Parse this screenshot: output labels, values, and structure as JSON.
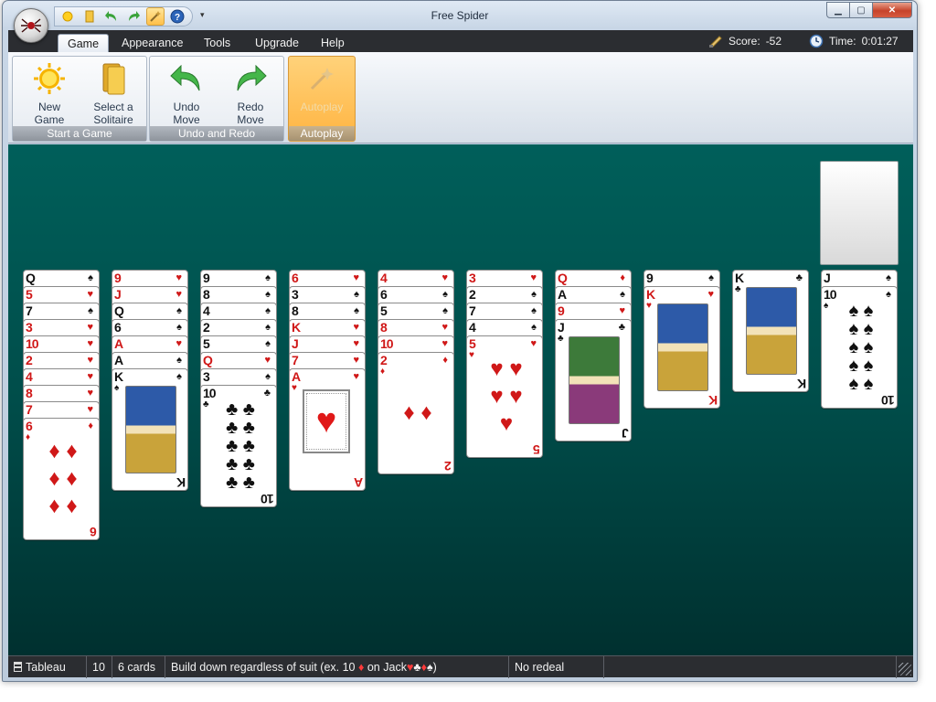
{
  "window": {
    "title": "Free Spider"
  },
  "tabs": [
    {
      "label": "Game",
      "active": true
    },
    {
      "label": "Appearance",
      "active": false
    },
    {
      "label": "Tools",
      "active": false
    },
    {
      "label": "Upgrade",
      "active": false
    },
    {
      "label": "Help",
      "active": false
    }
  ],
  "header": {
    "score_label": "Score:",
    "score": "-52",
    "time_label": "Time:",
    "time": "0:01:27"
  },
  "ribbon": {
    "groups": [
      {
        "label": "Start a Game",
        "buttons": [
          {
            "line1": "New",
            "line2": "Game",
            "icon": "sun-icon"
          },
          {
            "line1": "Select a",
            "line2": "Solitaire",
            "icon": "cards-icon"
          }
        ]
      },
      {
        "label": "Undo and Redo",
        "buttons": [
          {
            "line1": "Undo",
            "line2": "Move",
            "icon": "undo-arrow-icon"
          },
          {
            "line1": "Redo",
            "line2": "Move",
            "icon": "redo-arrow-icon"
          }
        ]
      },
      {
        "label": "Autoplay",
        "buttons": [
          {
            "line1": "Autoplay",
            "line2": "",
            "icon": "wand-icon",
            "disabled": true
          }
        ]
      }
    ]
  },
  "tableau": [
    {
      "column": 1,
      "cards": [
        "Q♠",
        "5♥",
        "7♠",
        "3♥",
        "10♥",
        "2♥",
        "4♥",
        "8♥",
        "7♥",
        "6♦"
      ]
    },
    {
      "column": 2,
      "cards": [
        "9♥",
        "J♥",
        "Q♠",
        "6♠",
        "A♥",
        "A♠",
        "K♠"
      ]
    },
    {
      "column": 3,
      "cards": [
        "9♠",
        "8♠",
        "4♠",
        "2♠",
        "5♠",
        "Q♥",
        "3♠",
        "10♣"
      ]
    },
    {
      "column": 4,
      "cards": [
        "6♥",
        "3♠",
        "8♠",
        "K♥",
        "J♥",
        "7♥",
        "A♥"
      ]
    },
    {
      "column": 5,
      "cards": [
        "4♥",
        "6♠",
        "5♠",
        "8♥",
        "10♥",
        "2♦"
      ]
    },
    {
      "column": 6,
      "cards": [
        "3♥",
        "2♠",
        "7♠",
        "4♠",
        "5♥"
      ]
    },
    {
      "column": 7,
      "cards": [
        "Q♦",
        "A♠",
        "9♥",
        "J♣"
      ]
    },
    {
      "column": 8,
      "cards": [
        "9♠",
        "K♥"
      ]
    },
    {
      "column": 9,
      "cards": [
        "K♣"
      ]
    },
    {
      "column": 10,
      "cards": [
        "J♠",
        "10♠"
      ]
    }
  ],
  "statusbar": {
    "area": "Tableau",
    "column": "10",
    "cards": "6 cards",
    "rule_prefix": "Build down regardless of suit (ex. 10",
    "rule_mid": "on Jack",
    "rule_suffix": ")",
    "redeal": "No redeal"
  }
}
